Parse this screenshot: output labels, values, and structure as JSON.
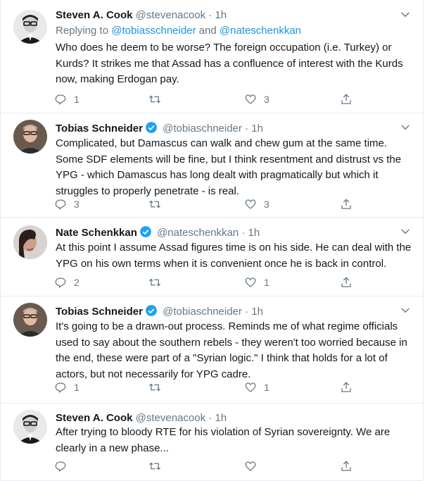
{
  "tweets": [
    {
      "name": "Steven A. Cook",
      "handle": "@stevenacook",
      "dot": "·",
      "time": "1h",
      "replying_prefix": "Replying to ",
      "replying_user1": "@tobiasschneider",
      "replying_and": " and ",
      "replying_user2": "@nateschenkkan",
      "text": "Who does he deem to be worse? The foreign occupation (i.e. Turkey) or Kurds? It strikes me that Assad has a confluence of interest with the Kurds now, making Erdogan pay.",
      "replies": "1",
      "retweets": "",
      "likes": "3"
    },
    {
      "name": "Tobias Schneider",
      "handle": "@tobiaschneider",
      "dot": "·",
      "time": "1h",
      "text": "Complicated, but Damascus can walk and chew gum at the same time. Some SDF elements will be fine, but I think resentment and distrust vs the YPG - which Damascus has long dealt with pragmatically but which it struggles to properly penetrate - is real.",
      "replies": "3",
      "retweets": "",
      "likes": "3"
    },
    {
      "name": "Nate Schenkkan",
      "handle": "@nateschenkkan",
      "dot": "·",
      "time": "1h",
      "text": "At this point I assume Assad figures time is on his side. He can deal with the YPG on his own terms when it is convenient once he is back in control.",
      "replies": "2",
      "retweets": "",
      "likes": "1"
    },
    {
      "name": "Tobias Schneider",
      "handle": "@tobiaschneider",
      "dot": "·",
      "time": "1h",
      "text": "It's going to be a drawn-out process. Reminds me of what regime officials used to say about the southern rebels - they weren't too worried because in the end, these were part of a \"Syrian logic.\" I think that holds for a lot of actors, but not necessarily for YPG cadre.",
      "replies": "1",
      "retweets": "",
      "likes": "1"
    },
    {
      "name": "Steven A. Cook",
      "handle": "@stevenacook",
      "dot": "·",
      "time": "1h",
      "text": "After trying to bloody RTE for his violation of Syrian sovereignty.  We are clearly in a new phase...",
      "replies": "",
      "retweets": "",
      "likes": ""
    }
  ],
  "icons": {
    "reply": "reply-icon",
    "retweet": "retweet-icon",
    "like": "heart-icon",
    "share": "share-icon",
    "more": "chevron-down-icon",
    "verified": "verified-badge-icon"
  },
  "colors": {
    "text": "#14171a",
    "secondary": "#657786",
    "link": "#1b95e0",
    "verified": "#1da1f2",
    "divider": "#e6ecf0"
  }
}
